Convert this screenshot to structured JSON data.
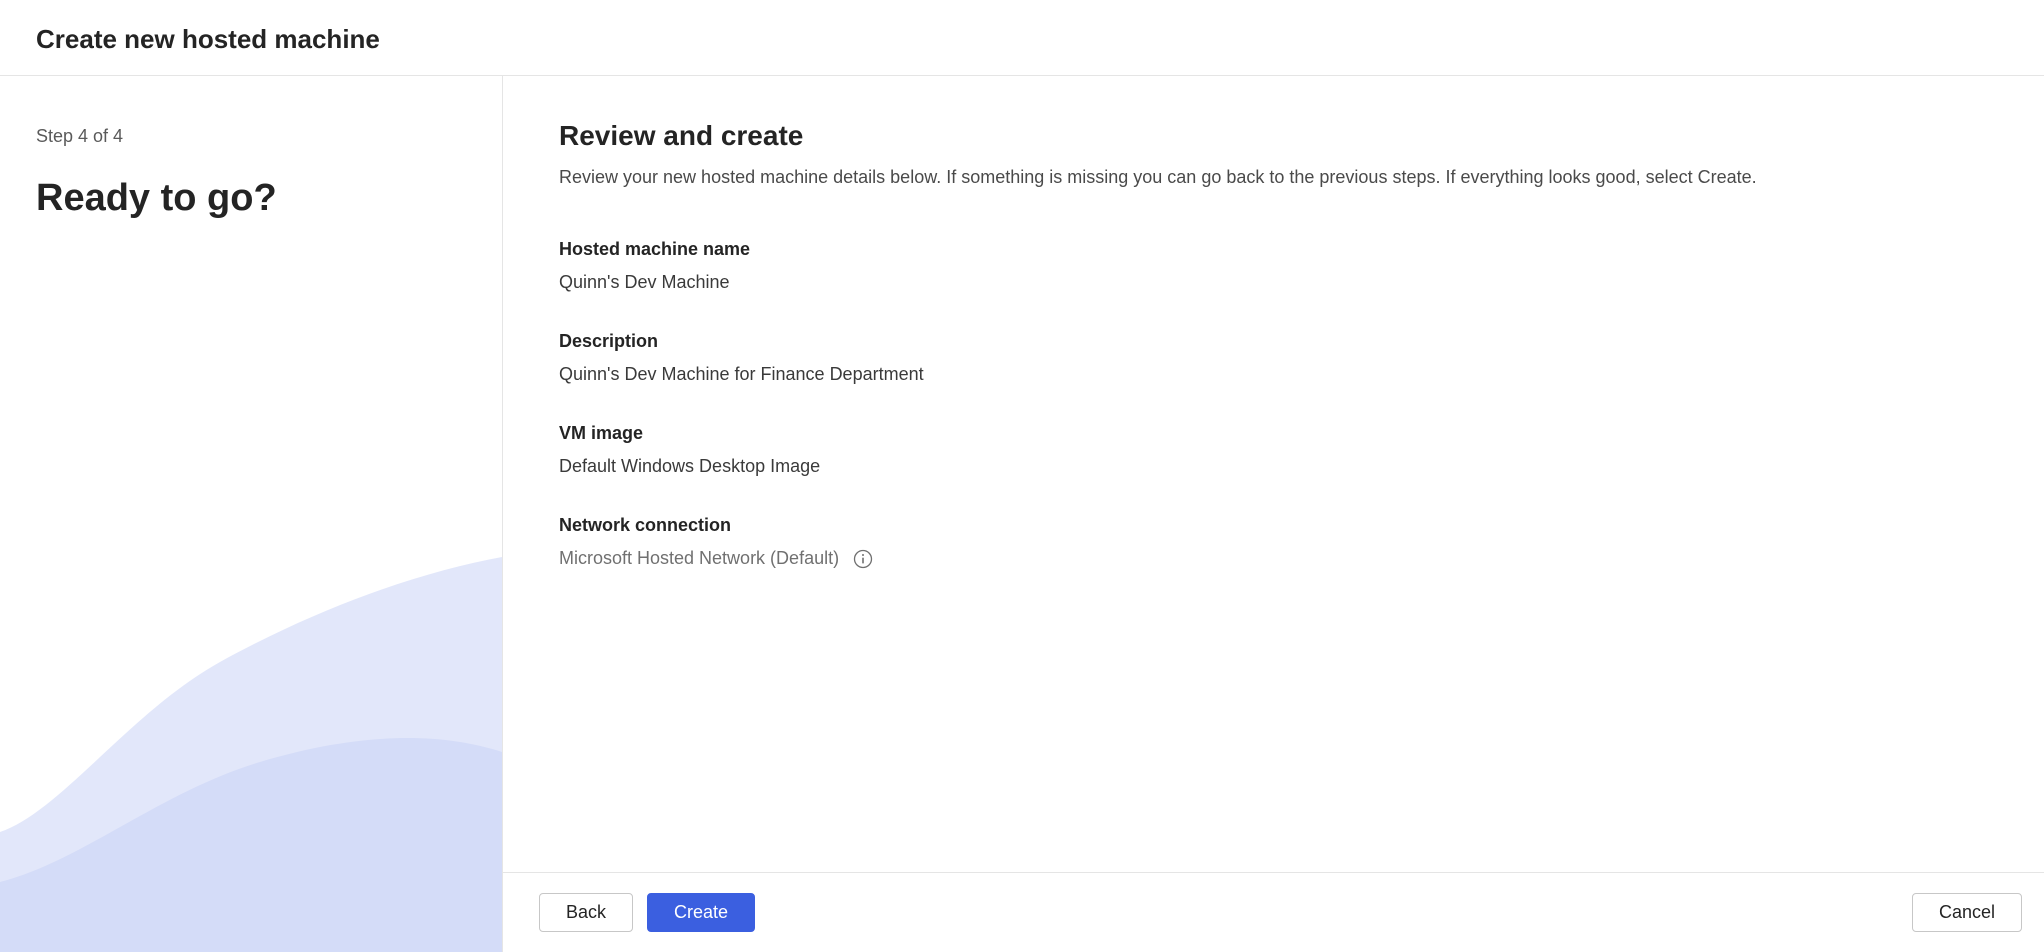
{
  "header": {
    "title": "Create new hosted machine"
  },
  "sidebar": {
    "step_indicator": "Step 4 of 4",
    "step_title": "Ready to go?"
  },
  "content": {
    "title": "Review and create",
    "description": "Review your new hosted machine details below. If something is missing you can go back to the previous steps. If everything looks good, select Create.",
    "fields": {
      "name": {
        "label": "Hosted machine name",
        "value": "Quinn's Dev Machine"
      },
      "description": {
        "label": "Description",
        "value": "Quinn's Dev Machine for Finance Department"
      },
      "vm_image": {
        "label": "VM image",
        "value": "Default Windows Desktop Image"
      },
      "network": {
        "label": "Network connection",
        "value": "Microsoft Hosted Network (Default)"
      }
    }
  },
  "footer": {
    "back_label": "Back",
    "create_label": "Create",
    "cancel_label": "Cancel"
  }
}
